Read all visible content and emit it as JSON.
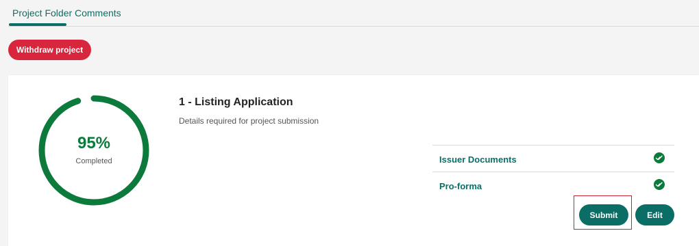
{
  "tabs": {
    "project_folder": "Project Folder",
    "comments": "Comments",
    "active": "Project Folder"
  },
  "actions": {
    "withdraw_label": "Withdraw project"
  },
  "card": {
    "progress_percent_text": "95%",
    "progress_fraction": 0.95,
    "progress_label": "Completed",
    "title": "1 - Listing Application",
    "description": "Details required for project submission",
    "documents": [
      {
        "label": "Issuer Documents",
        "status_icon": "check-circle-icon"
      },
      {
        "label": "Pro-forma",
        "status_icon": "check-circle-icon"
      }
    ],
    "submit_label": "Submit",
    "edit_label": "Edit"
  },
  "colors": {
    "accent": "#0b6e66",
    "progress": "#0b7a3b",
    "danger": "#d8263c",
    "highlight_outline": "#c6242f"
  }
}
